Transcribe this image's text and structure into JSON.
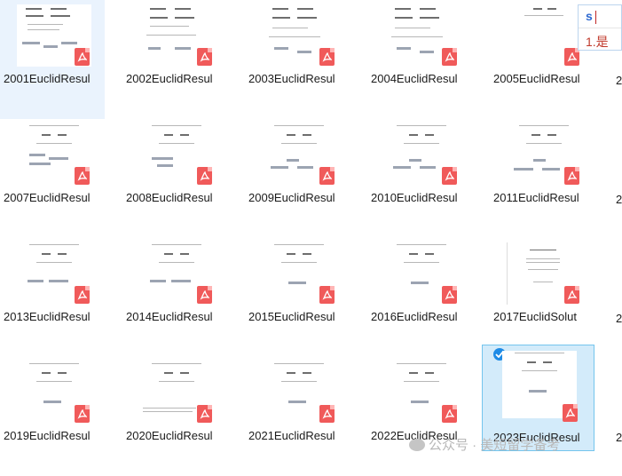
{
  "files": [
    {
      "label": "2001EuclidResul",
      "state": "hover"
    },
    {
      "label": "2002EuclidResul"
    },
    {
      "label": "2003EuclidResul"
    },
    {
      "label": "2004EuclidResul"
    },
    {
      "label": "2005EuclidResul"
    },
    {
      "label": "2007EuclidResul"
    },
    {
      "label": "2008EuclidResul"
    },
    {
      "label": "2009EuclidResul"
    },
    {
      "label": "2010EuclidResul"
    },
    {
      "label": "2011EuclidResul"
    },
    {
      "label": "2013EuclidResul"
    },
    {
      "label": "2014EuclidResul"
    },
    {
      "label": "2015EuclidResul"
    },
    {
      "label": "2016EuclidResul"
    },
    {
      "label": "2017EuclidSolut"
    },
    {
      "label": "2019EuclidResul"
    },
    {
      "label": "2020EuclidResul"
    },
    {
      "label": "2021EuclidResul"
    },
    {
      "label": "2022EuclidResul"
    },
    {
      "label": "2023EuclidResul",
      "state": "selected"
    }
  ],
  "partial_column": {
    "row1": "2",
    "row2": "2",
    "row3": "2",
    "row4": "2"
  },
  "ime": {
    "input": "s",
    "candidate": "1.是"
  },
  "watermark": {
    "text": "公众号 · 美短留学备考"
  },
  "colors": {
    "pdf_badge": "#f05a5a",
    "selected_border": "#74c5ed",
    "check": "#1e8be6"
  },
  "icons": {
    "file_type": "pdf-icon",
    "selected": "checkmark-icon"
  }
}
